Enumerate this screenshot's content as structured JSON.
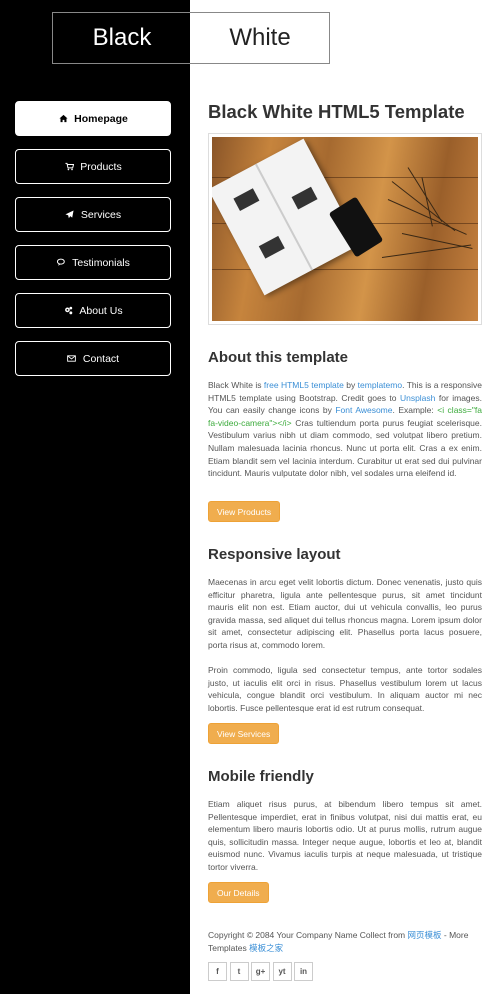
{
  "logo": {
    "black": "Black",
    "white": "White"
  },
  "nav": {
    "items": [
      {
        "label": "Homepage",
        "icon": "home-icon"
      },
      {
        "label": "Products",
        "icon": "cart-icon"
      },
      {
        "label": "Services",
        "icon": "paper-plane-icon"
      },
      {
        "label": "Testimonials",
        "icon": "comments-icon"
      },
      {
        "label": "About Us",
        "icon": "cogs-icon"
      },
      {
        "label": "Contact",
        "icon": "envelope-icon"
      }
    ]
  },
  "main": {
    "title": "Black White HTML5 Template",
    "about": {
      "heading": "About this template",
      "p_1": "Black White is ",
      "link_1": "free HTML5 template",
      "p_2": " by ",
      "link_2": "templatemo",
      "p_3": ". This is a responsive HTML5 template using Bootstrap. Credit goes to ",
      "link_3": "Unsplash",
      "p_4": " for images. You can easily change icons by ",
      "link_4": "Font Awesome",
      "p_5": ". Example: ",
      "code": "<i class=\"fa fa-video-camera\"></i>",
      "p_6": " Cras tultiendum porta purus feugiat scelerisque. Vestibulum varius nibh ut diam commodo, sed volutpat libero pretium. Nullam malesuada lacinia rhoncus. Nunc ut porta elit. Cras a ex enim. Etiam blandit sem vel lacinia interdum. Curabitur ut erat sed dui pulvinar tincidunt. Mauris vulputate dolor nibh, vel sodales urna eleifend id.",
      "button": "View Products"
    },
    "responsive": {
      "heading": "Responsive layout",
      "para1": "Maecenas in arcu eget velit lobortis dictum. Donec venenatis, justo quis efficitur pharetra, ligula ante pellentesque purus, sit amet tincidunt mauris elit non est. Etiam auctor, dui ut vehicula convallis, leo purus gravida massa, sed aliquet dui tellus rhoncus magna. Lorem ipsum dolor sit amet, consectetur adipiscing elit. Phasellus porta lacus posuere, porta risus at, commodo lorem.",
      "para2": "Proin commodo, ligula sed consectetur tempus, ante tortor sodales justo, ut iaculis elit orci in risus. Phasellus vestibulum lorem ut lacus vehicula, congue blandit orci vestibulum. In aliquam auctor mi nec lobortis. Fusce pellentesque erat id est rutrum consequat.",
      "button": "View Services"
    },
    "mobile": {
      "heading": "Mobile friendly",
      "para": "Etiam aliquet risus purus, at bibendum libero tempus sit amet. Pellentesque imperdiet, erat in finibus volutpat, nisi dui mattis erat, eu elementum libero mauris lobortis odio. Ut at purus mollis, rutrum augue quis, sollicitudin massa. Integer neque augue, lobortis et leo at, blandit euismod nunc. Vivamus iaculis turpis at neque malesuada, ut tristique tortor viverra.",
      "button": "Our Details"
    },
    "footer": {
      "text_1": "Copyright © 2084 Your Company Name Collect from ",
      "link_1": "网页模板",
      "text_2": " - More Templates ",
      "link_2": "模板之家"
    },
    "social": [
      {
        "label": "f",
        "icon": "facebook-icon"
      },
      {
        "label": "t",
        "icon": "twitter-icon"
      },
      {
        "label": "g+",
        "icon": "google-plus-icon"
      },
      {
        "label": "yt",
        "icon": "youtube-icon"
      },
      {
        "label": "in",
        "icon": "linkedin-icon"
      }
    ]
  },
  "colors": {
    "sidebar": "#000000",
    "accent_button": "#f0ad4e",
    "link": "#3b8fd6",
    "code": "#3cab3c"
  }
}
